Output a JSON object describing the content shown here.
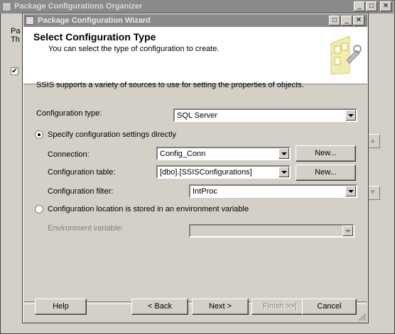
{
  "back_window": {
    "title": "Package Configurations Organizer",
    "side_text_line1": "Pa",
    "side_text_line2": "Th",
    "checkbox_mark": "✔"
  },
  "wizard": {
    "title": "Package Configuration Wizard",
    "header": {
      "title": "Select Configuration Type",
      "subtitle": "You can select the type of configuration to create."
    },
    "intro": "SSIS supports a variety of sources to use for setting the properties of objects.",
    "config_type": {
      "label": "Configuration type:",
      "value": "SQL Server"
    },
    "radio_direct": {
      "label": "Specify configuration settings directly"
    },
    "connection": {
      "label": "Connection:",
      "value": "Config_Conn",
      "button": "New..."
    },
    "config_table": {
      "label": "Configuration table:",
      "value": "[dbo].[SSISConfigurations]",
      "button": "New..."
    },
    "config_filter": {
      "label": "Configuration filter:",
      "value": "IntProc"
    },
    "radio_env": {
      "label": "Configuration location is stored in an environment variable"
    },
    "env_variable": {
      "label": "Environment variable:",
      "value": ""
    },
    "buttons": {
      "help": "Help",
      "back": "< Back",
      "next": "Next >",
      "finish": "Finish >>|",
      "cancel": "Cancel"
    }
  },
  "colors": {
    "title_bar_inactive": "#8a8a8a",
    "face": "#d4d0c8",
    "header_bg": "#ffffff"
  }
}
